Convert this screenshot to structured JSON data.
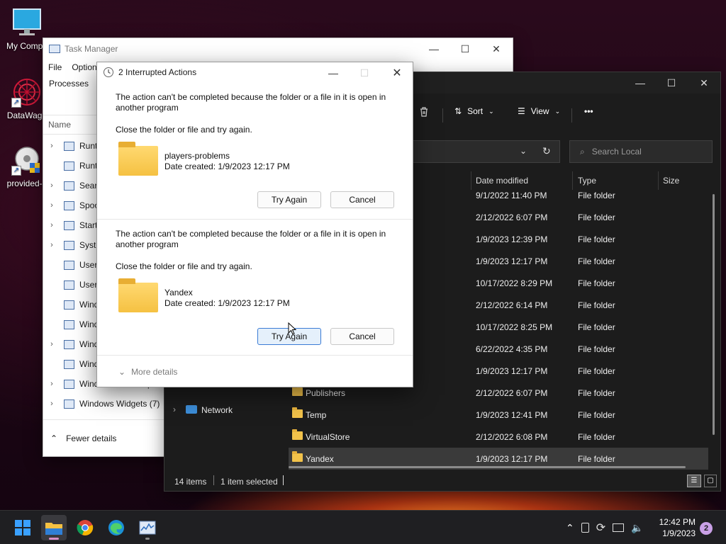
{
  "desktop": {
    "icons": [
      {
        "label": "My Compu"
      },
      {
        "label": "DataWago"
      },
      {
        "label": "provided-p"
      }
    ]
  },
  "taskmgr": {
    "title": "Task Manager",
    "menu": [
      "File",
      "Option"
    ],
    "tabs": [
      "Processes",
      "p"
    ],
    "column_name": "Name",
    "rows": [
      {
        "label": "Runt",
        "expand": true
      },
      {
        "label": "Runt",
        "expand": false
      },
      {
        "label": "Searc",
        "expand": true
      },
      {
        "label": "Spoo",
        "expand": true
      },
      {
        "label": "Start",
        "expand": true
      },
      {
        "label": "Syste",
        "expand": true
      },
      {
        "label": "User",
        "expand": false
      },
      {
        "label": "User",
        "expand": false
      },
      {
        "label": "Wind",
        "expand": false
      },
      {
        "label": "Wind",
        "expand": false
      },
      {
        "label": "Wind",
        "expand": true
      },
      {
        "label": "Wind",
        "expand": false
      },
      {
        "label": "Windows Shell Exp",
        "expand": true
      },
      {
        "label": "Windows Widgets (7)",
        "expand": true
      }
    ],
    "fewer_details": "Fewer details"
  },
  "explorer": {
    "toolbar": {
      "sort": "Sort",
      "view": "View",
      "more": "•••"
    },
    "search_placeholder": "Search Local",
    "columns": {
      "date": "Date modified",
      "type": "Type",
      "size": "Size"
    },
    "rows": [
      {
        "name": "",
        "date": "9/1/2022 11:40 PM",
        "type": "File folder",
        "selected": false
      },
      {
        "name": "",
        "date": "2/12/2022 6:07 PM",
        "type": "File folder",
        "selected": false
      },
      {
        "name": "",
        "date": "1/9/2023 12:39 PM",
        "type": "File folder",
        "selected": false
      },
      {
        "name": "",
        "date": "1/9/2023 12:17 PM",
        "type": "File folder",
        "selected": false
      },
      {
        "name": "",
        "date": "10/17/2022 8:29 PM",
        "type": "File folder",
        "selected": false
      },
      {
        "name": "",
        "date": "2/12/2022 6:14 PM",
        "type": "File folder",
        "selected": false
      },
      {
        "name": "",
        "date": "10/17/2022 8:25 PM",
        "type": "File folder",
        "selected": false
      },
      {
        "name": "",
        "date": "6/22/2022 4:35 PM",
        "type": "File folder",
        "selected": false
      },
      {
        "name": "",
        "date": "1/9/2023 12:17 PM",
        "type": "File folder",
        "selected": false
      },
      {
        "name": "Publishers",
        "date": "2/12/2022 6:07 PM",
        "type": "File folder",
        "selected": false
      },
      {
        "name": "Temp",
        "date": "1/9/2023 12:41 PM",
        "type": "File folder",
        "selected": false
      },
      {
        "name": "VirtualStore",
        "date": "2/12/2022 6:08 PM",
        "type": "File folder",
        "selected": false
      },
      {
        "name": "Yandex",
        "date": "1/9/2023 12:17 PM",
        "type": "File folder",
        "selected": true
      }
    ],
    "nav_network": "Network",
    "status_items": "14 items",
    "status_selected": "1 item selected"
  },
  "dialog": {
    "title": "2 Interrupted Actions",
    "items": [
      {
        "message": "The action can't be completed because the folder or a file in it is open in another program",
        "instruction": "Close the folder or file and try again.",
        "name": "players-problems",
        "date": "Date created: 1/9/2023 12:17 PM",
        "try_again": "Try Again",
        "cancel": "Cancel"
      },
      {
        "message": "The action can't be completed because the folder or a file in it is open in another program",
        "instruction": "Close the folder or file and try again.",
        "name": "Yandex",
        "date": "Date created: 1/9/2023 12:17 PM",
        "try_again": "Try Again",
        "cancel": "Cancel"
      }
    ],
    "more_details": "More details"
  },
  "taskbar": {
    "time": "12:42 PM",
    "date": "1/9/2023",
    "notifications": "2"
  },
  "colors": {
    "accent": "#3a7bd5",
    "folder": "#f5c142",
    "explorer_bg": "#1c1c1c"
  }
}
